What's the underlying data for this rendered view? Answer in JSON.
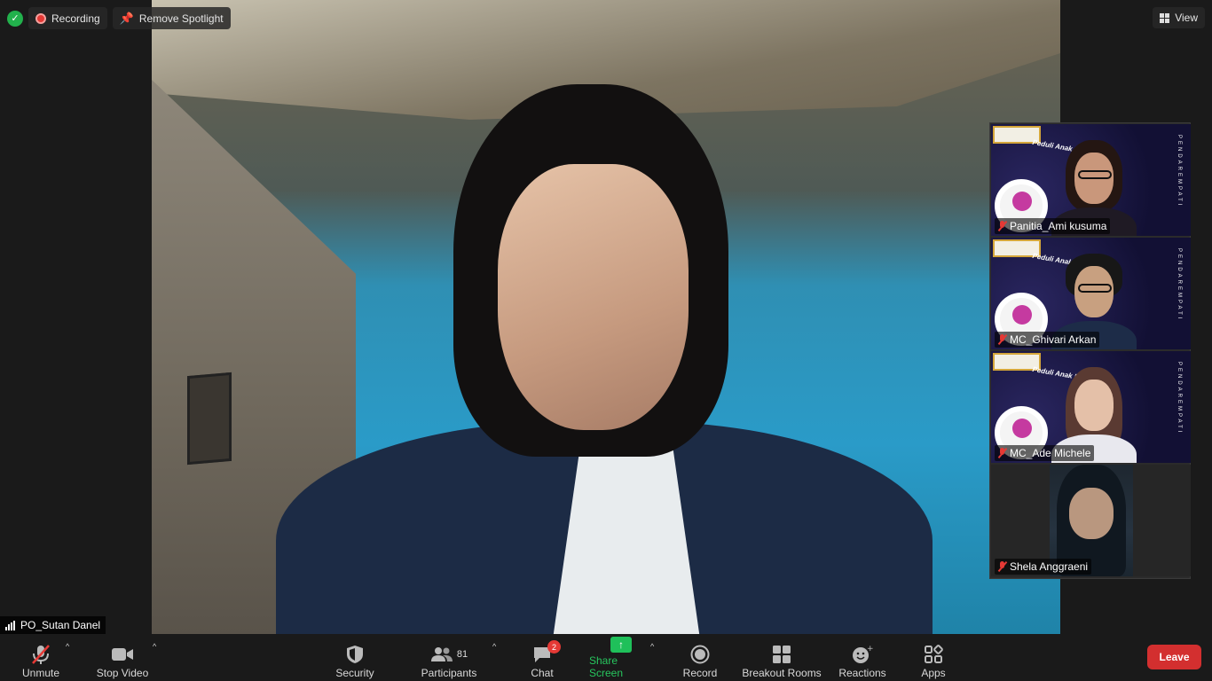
{
  "window": {
    "view_label": "View"
  },
  "top_badges": {
    "recording_label": "Recording",
    "remove_spotlight_label": "Remove Spotlight"
  },
  "active_speaker": {
    "name": "PO_Sutan Danel"
  },
  "gallery": [
    {
      "name": "Panitia_Ami kusuma",
      "muted": true,
      "slogan": "Peduli Anak Masa Depan",
      "side_text": "PENDAREMPATI"
    },
    {
      "name": "MC_Ghivari Arkan",
      "muted": true,
      "slogan": "Peduli Anak Masa Depan",
      "side_text": "PENDAREMPATI"
    },
    {
      "name": "MC_Ade Michele",
      "muted": true,
      "slogan": "Peduli Anak Masa Depan",
      "side_text": "PENDAREMPATI"
    },
    {
      "name": "Shela Anggraeni",
      "muted": true
    }
  ],
  "toolbar": {
    "unmute_label": "Unmute",
    "stop_video_label": "Stop Video",
    "security_label": "Security",
    "participants_label": "Participants",
    "participants_count": "81",
    "chat_label": "Chat",
    "chat_badge": "2",
    "share_screen_label": "Share Screen",
    "record_label": "Record",
    "breakout_label": "Breakout Rooms",
    "reactions_label": "Reactions",
    "apps_label": "Apps",
    "leave_label": "Leave"
  },
  "colors": {
    "leave": "#d32f2f",
    "share": "#1fc05a",
    "mute": "#e53935",
    "secure": "#22b14c"
  }
}
